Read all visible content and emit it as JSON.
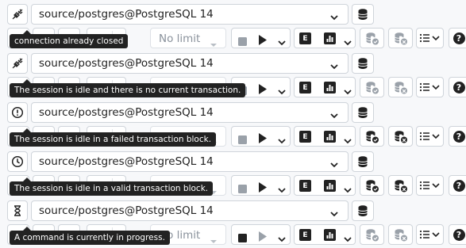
{
  "rows": [
    {
      "status_icon": "plug-disconnected-icon",
      "connection": "source/postgres@PostgreSQL 14",
      "tooltip": "connection already closed",
      "limit": "No limit",
      "limit_visible": true
    },
    {
      "status_icon": "plug-disconnected-icon",
      "connection": "source/postgres@PostgreSQL 14",
      "tooltip": "The session is idle and there is no current transaction.",
      "limit": "",
      "limit_visible": false
    },
    {
      "status_icon": "alert-circle-icon",
      "connection": "source/postgres@PostgreSQL 14",
      "tooltip": "The session is idle in a failed transaction block.",
      "limit": "",
      "limit_visible": false
    },
    {
      "status_icon": "clock-icon",
      "connection": "source/postgres@PostgreSQL 14",
      "tooltip": "The session is idle in a valid transaction block.",
      "limit": "t",
      "limit_visible": false
    },
    {
      "status_icon": "hourglass-icon",
      "connection": "source/postgres@PostgreSQL 14",
      "tooltip": "A command is currently in progress.",
      "limit": "No limit",
      "limit_visible": true
    }
  ],
  "toolbar": {
    "execute_icon": "play-icon",
    "explain_label": "E",
    "analyze_icon": "bar-chart-icon",
    "commit_icon": "database-check-icon",
    "rollback_icon": "database-undo-icon",
    "macros_icon": "list-icon",
    "help_label": "?"
  },
  "colors": {
    "dark": "#222222",
    "muted": "#9aa1a9",
    "border": "#cfd4da",
    "tooltip_bg": "#222222"
  }
}
